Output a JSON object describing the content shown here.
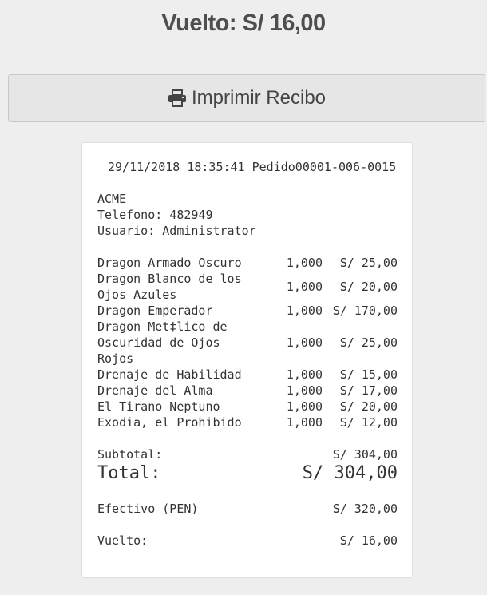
{
  "header": {
    "title": "Vuelto: S/ 16,00"
  },
  "print_button": {
    "label": "Imprimir Recibo",
    "icon": "printer-icon"
  },
  "receipt": {
    "datetime": "29/11/2018 18:35:41",
    "order": "Pedido00001-006-0015",
    "company": "ACME",
    "phone_line": "Telefono: 482949",
    "user_line": "Usuario: Administrator",
    "items": [
      {
        "name": "Dragon Armado Oscuro",
        "qty": "1,000",
        "price": "S/ 25,00"
      },
      {
        "name": "Dragon Blanco de los\nOjos Azules",
        "qty": "1,000",
        "price": "S/ 20,00"
      },
      {
        "name": "Dragon Emperador",
        "qty": "1,000",
        "price": "S/ 170,00"
      },
      {
        "name": "Dragon Met‡lico de\nOscuridad de Ojos\nRojos",
        "qty": "1,000",
        "price": "S/ 25,00"
      },
      {
        "name": "Drenaje de Habilidad",
        "qty": "1,000",
        "price": "S/ 15,00"
      },
      {
        "name": "Drenaje del Alma",
        "qty": "1,000",
        "price": "S/ 17,00"
      },
      {
        "name": "El Tirano Neptuno",
        "qty": "1,000",
        "price": "S/ 20,00"
      },
      {
        "name": "Exodia, el Prohibido",
        "qty": "1,000",
        "price": "S/ 12,00"
      }
    ],
    "subtotal_label": "Subtotal:",
    "subtotal_value": "S/ 304,00",
    "total_label": "Total:",
    "total_value": "S/ 304,00",
    "cash_label": "Efectivo (PEN)",
    "cash_value": "S/ 320,00",
    "change_label": "Vuelto:",
    "change_value": "S/ 16,00"
  }
}
